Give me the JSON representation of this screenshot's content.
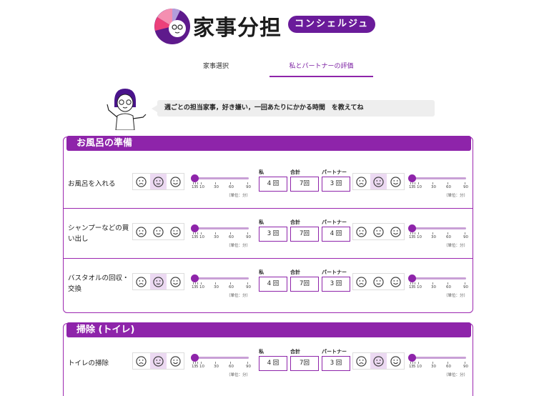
{
  "header": {
    "logo_title": "家事分担",
    "logo_badge": "コンシェルジュ"
  },
  "tabs": [
    {
      "label": "家事選択",
      "active": false
    },
    {
      "label": "私とパートナーの評価",
      "active": true
    }
  ],
  "instruction": "週ごとの担当家事，好き嫌い，一回あたりにかかる時間　を教えてね",
  "colors": {
    "accent": "#8e24aa",
    "dark": "#6a1b9a",
    "track": "#c9a0d6"
  },
  "slider": {
    "tick_labels": [
      "1",
      "3",
      "5",
      "10",
      "30",
      "60",
      "90"
    ],
    "unit": "（単位：分）"
  },
  "counter_labels": {
    "me": "私",
    "total": "合計",
    "partner": "パートナー"
  },
  "face_icons": [
    "frown-face-icon",
    "neutral-face-icon",
    "smile-face-icon"
  ],
  "sections": [
    {
      "title": "お風呂の準備",
      "tasks": [
        {
          "name": "お風呂を入れる",
          "me_face": "neutral",
          "me_time": 1,
          "me_count": "4 回",
          "total": "7回",
          "partner_count": "3 回",
          "partner_face": "neutral",
          "partner_time": 1
        },
        {
          "name": "シャンプーなどの買い出し",
          "me_face": "none",
          "me_time": 1,
          "me_count": "3 回",
          "total": "7回",
          "partner_count": "4 回",
          "partner_face": "none",
          "partner_time": 1
        },
        {
          "name": "バスタオルの回収・交換",
          "me_face": "neutral",
          "me_time": 1,
          "me_count": "4 回",
          "total": "7回",
          "partner_count": "3 回",
          "partner_face": "none",
          "partner_time": 1
        }
      ]
    },
    {
      "title": "掃除 (トイレ)",
      "tasks": [
        {
          "name": "トイレの掃除",
          "me_face": "neutral",
          "me_time": 1,
          "me_count": "4 回",
          "total": "7回",
          "partner_count": "3 回",
          "partner_face": "neutral",
          "partner_time": 1
        }
      ]
    }
  ]
}
